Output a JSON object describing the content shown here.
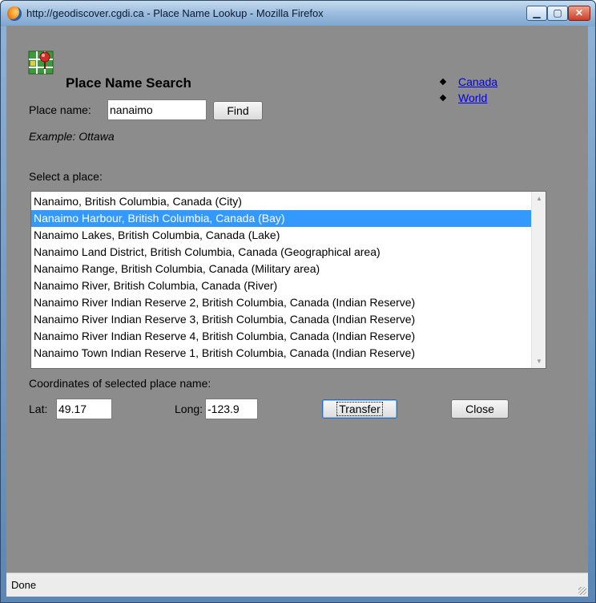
{
  "window": {
    "title": "http://geodiscover.cgdi.ca - Place Name Lookup - Mozilla Firefox",
    "minimize_icon": "minimize-icon",
    "maximize_icon": "maximize-icon",
    "close_icon": "close-icon"
  },
  "header": {
    "title": "Place Name Search",
    "app_icon": "map-pin-icon"
  },
  "links": [
    {
      "label": "Canada"
    },
    {
      "label": "World"
    }
  ],
  "search": {
    "label": "Place name:",
    "value": "nanaimo",
    "find_label": "Find",
    "example": "Example: Ottawa"
  },
  "results": {
    "label": "Select a place:",
    "items": [
      "Nanaimo, British Columbia, Canada (City)",
      "Nanaimo Harbour, British Columbia, Canada (Bay)",
      "Nanaimo Lakes, British Columbia, Canada (Lake)",
      "Nanaimo Land District, British Columbia, Canada (Geographical area)",
      "Nanaimo Range, British Columbia, Canada (Military area)",
      "Nanaimo River, British Columbia, Canada (River)",
      "Nanaimo River Indian Reserve 2, British Columbia, Canada (Indian Reserve)",
      "Nanaimo River Indian Reserve 3, British Columbia, Canada (Indian Reserve)",
      "Nanaimo River Indian Reserve 4, British Columbia, Canada (Indian Reserve)",
      "Nanaimo Town Indian Reserve 1, British Columbia, Canada (Indian Reserve)"
    ],
    "selected_index": 1
  },
  "coordinates": {
    "label": "Coordinates of selected place name:",
    "lat_label": "Lat:",
    "lat_value": "49.17",
    "long_label": "Long:",
    "long_value": "-123.9",
    "transfer_label": "Transfer",
    "close_label": "Close"
  },
  "status": {
    "text": "Done"
  },
  "colors": {
    "content_background": "#8c8c8c",
    "selection": "#3399ff",
    "link": "#0000ee"
  }
}
